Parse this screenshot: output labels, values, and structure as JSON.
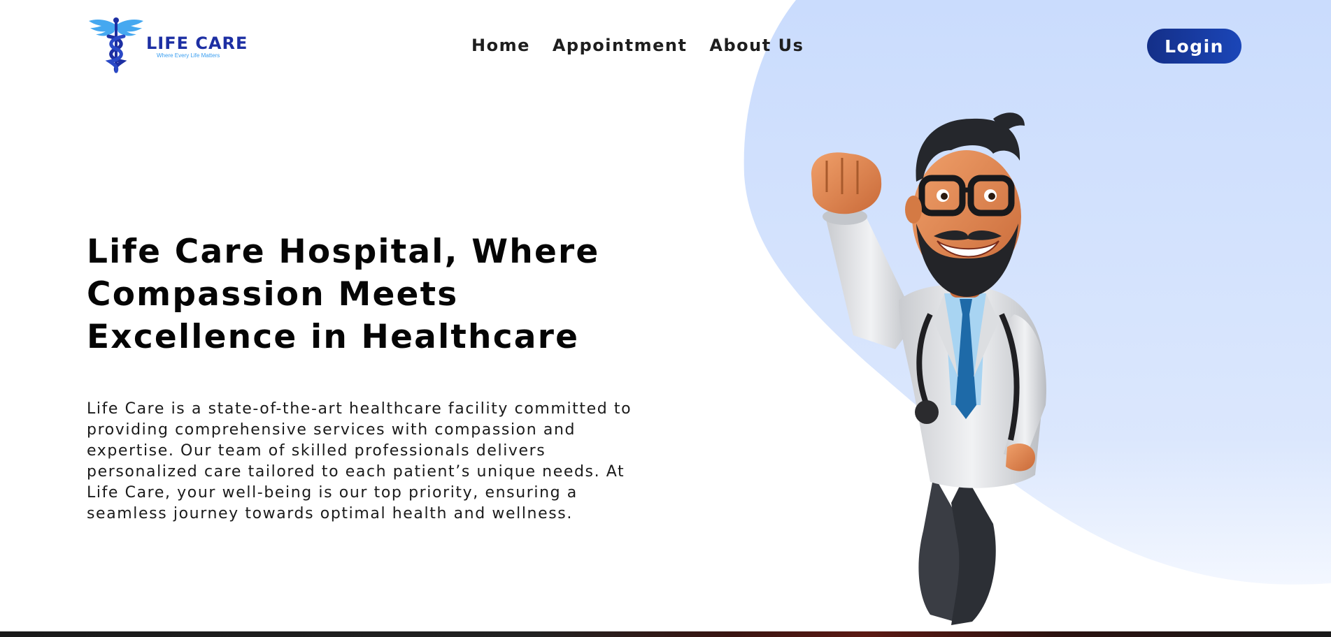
{
  "brand": {
    "name": "LIFE CARE",
    "tagline": "Where Every Life Matters",
    "primary_color": "#1d2fa3",
    "accent_color": "#3a9ef0",
    "logo_icon": "caduceus-icon"
  },
  "nav": {
    "items": [
      {
        "label": "Home"
      },
      {
        "label": "Appointment"
      },
      {
        "label": "About Us"
      }
    ]
  },
  "header": {
    "login_label": "Login",
    "login_color": "#142f88"
  },
  "hero": {
    "title": "Life Care Hospital, Where Compassion Meets Excellence in Healthcare",
    "description": "Life Care is a state-of-the-art healthcare facility committed to providing comprehensive services with compassion and expertise. Our team of skilled professionals delivers personalized care tailored to each patient’s unique needs. At Life Care, your well-being is our top priority, ensuring a seamless journey towards optimal health and wellness.",
    "background_color": "#cddfff",
    "illustration": "cartoon-doctor-flying"
  }
}
